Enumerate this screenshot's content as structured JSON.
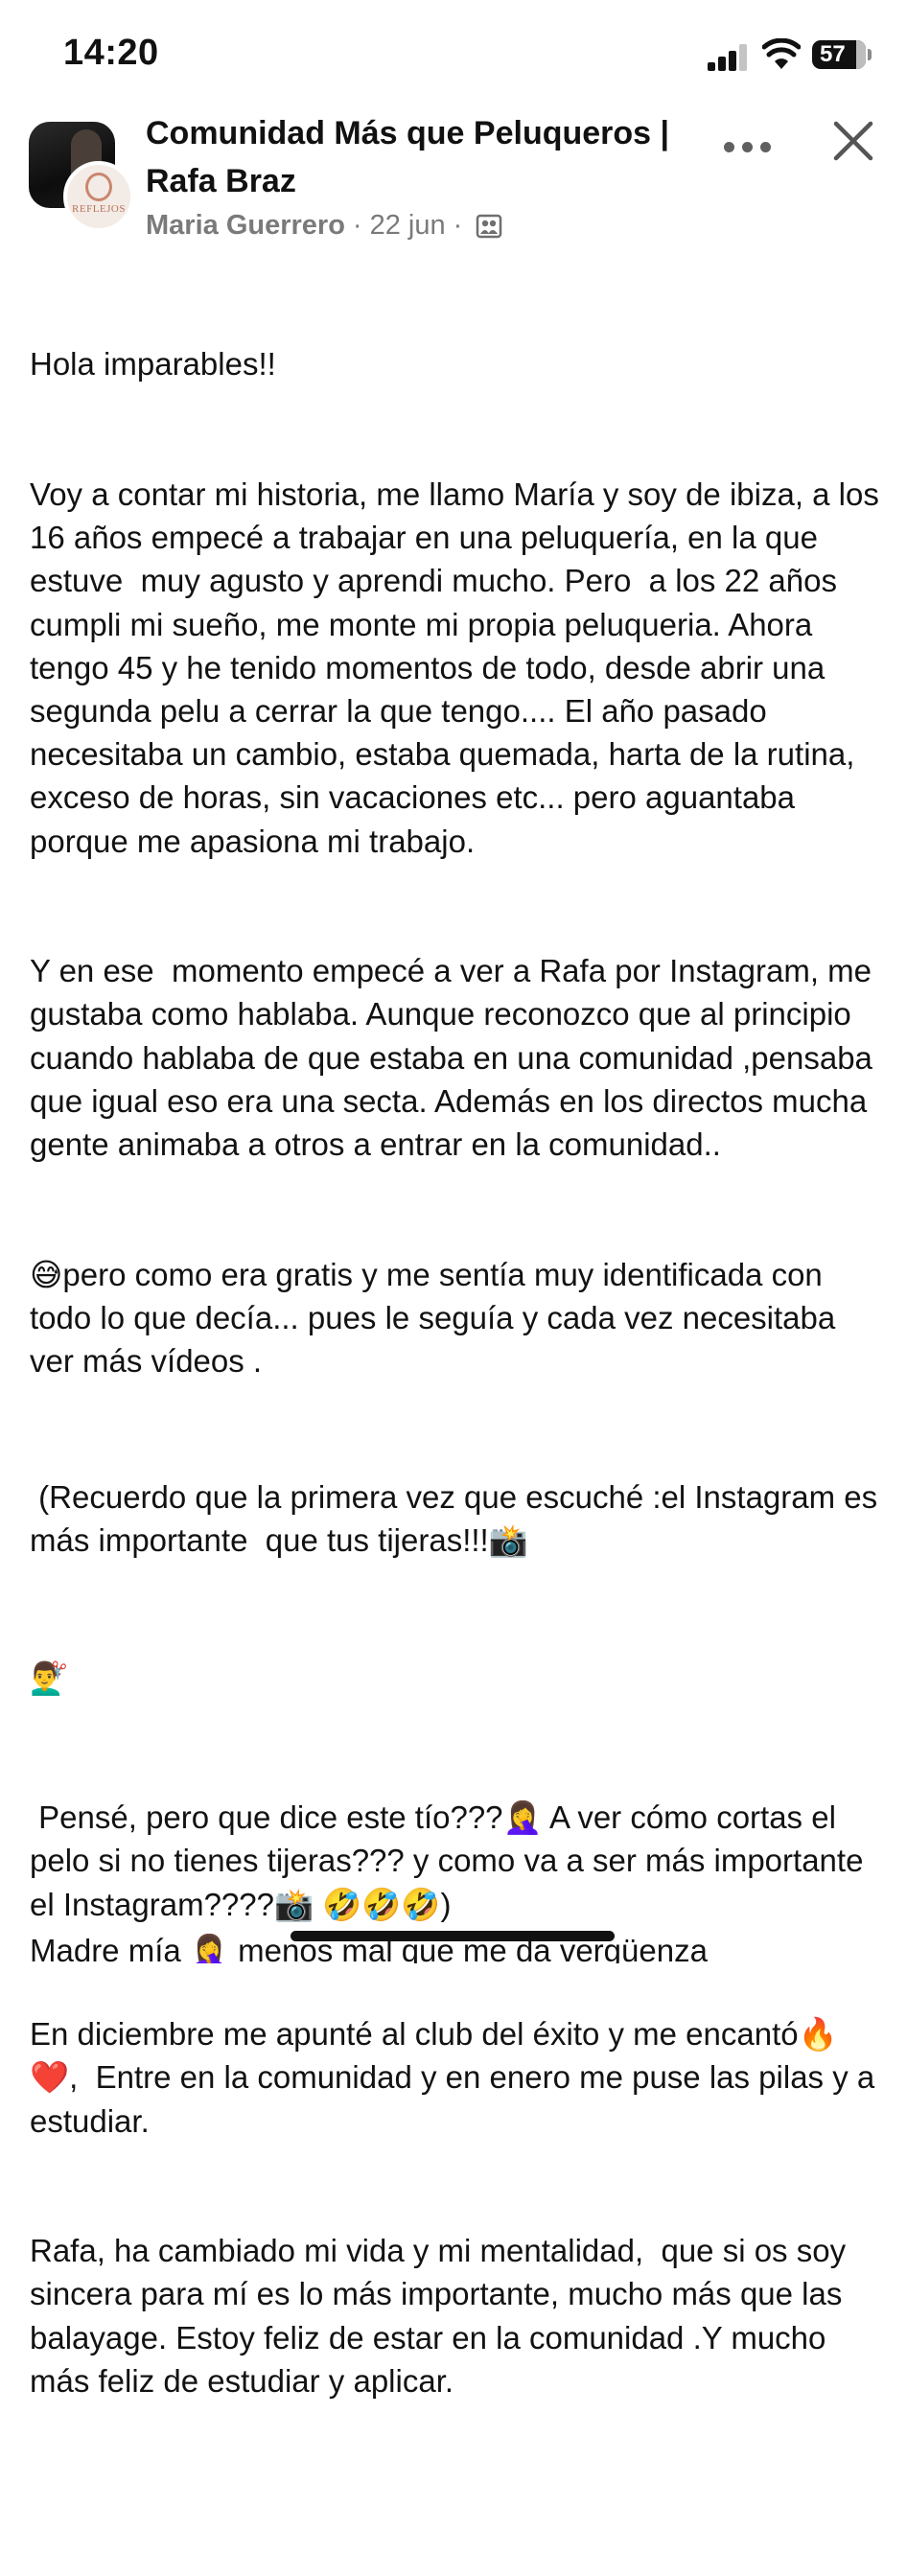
{
  "status_bar": {
    "time": "14:20",
    "battery": "57"
  },
  "header": {
    "group_name": "Comunidad Más que Peluqueros | Rafa Braz",
    "author": "Maria Guerrero",
    "date": "22 jun",
    "avatar_logo_text": "REFLEJOS",
    "privacy_icon": "group-members-icon"
  },
  "post": {
    "paragraphs": [
      "Hola imparables!!",
      "Voy a contar mi historia, me llamo María y soy de ibiza, a los  16 años empecé a trabajar en una peluquería, en la que estuve  muy agusto y aprendi mucho. Pero  a los 22 años cumpli mi sueño, me monte mi propia peluqueria. Ahora tengo 45 y he tenido momentos de todo, desde abrir una segunda pelu a cerrar la que tengo.... El año pasado necesitaba un cambio, estaba quemada, harta de la rutina, exceso de horas, sin vacaciones etc... pero aguantaba porque me apasiona mi trabajo.",
      "Y en ese  momento empecé a ver a Rafa por Instagram, me gustaba como hablaba. Aunque reconozco que al principio cuando hablaba de que estaba en una comunidad ,pensaba que igual eso era una secta. Además en los directos mucha gente animaba a otros a entrar en la comunidad..",
      "😅pero como era gratis y me sentía muy identificada con todo lo que decía... pues le seguía y cada vez necesitaba ver más vídeos .",
      " (Recuerdo que la primera vez que escuché :el Instagram es más importante  que tus tijeras!!!📸",
      "💇‍♂️",
      " Pensé, pero que dice este tío???🤦‍♀️ A ver cómo cortas el  pelo si no tienes tijeras??? y como va a ser más importante el Instagram????📸 🤣🤣🤣)",
      "En diciembre me apunté al club del éxito y me encantó🔥❤️,  Entre en la comunidad y en enero me puse las pilas y a estudiar.",
      "Rafa, ha cambiado mi vida y mi mentalidad,  que si os soy sincera para mí es lo más importante, mucho más que las balayage. Estoy feliz de estar en la comunidad .Y mucho más feliz de estudiar y aplicar.",
      "",
      "Madre mía 🤦‍♀️ menos mal que me da vergüenza"
    ]
  }
}
